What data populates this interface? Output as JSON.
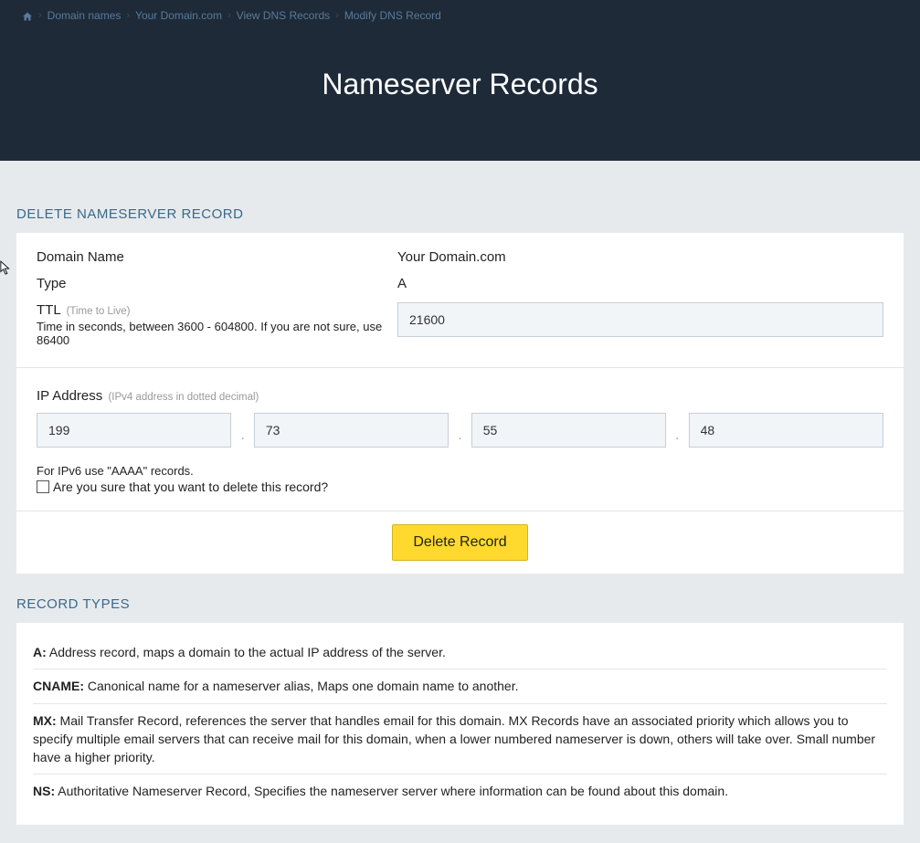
{
  "breadcrumb": {
    "items": [
      "Domain names",
      "Your Domain.com",
      "View DNS Records"
    ],
    "current": "Modify DNS Record"
  },
  "page_title": "Nameserver Records",
  "section_delete_title": "DELETE NAMESERVER RECORD",
  "form": {
    "domain_label": "Domain Name",
    "domain_value": "Your Domain.com",
    "type_label": "Type",
    "type_value": "A",
    "ttl_label": "TTL",
    "ttl_hint": "(Time to Live)",
    "ttl_desc": "Time in seconds, between 3600 - 604800. If you are not sure, use 86400",
    "ttl_value": "21600",
    "ip_label": "IP Address",
    "ip_hint": "(IPv4 address in dotted decimal)",
    "ip": [
      "199",
      "73",
      "55",
      "48"
    ],
    "ipv6_hint": "For IPv6 use \"AAAA\" records.",
    "confirm_label": "Are you sure that you want to delete this record?",
    "delete_btn": "Delete Record"
  },
  "types_title": "RECORD TYPES",
  "types": [
    {
      "k": "A:",
      "v": " Address record, maps a domain to the actual IP address of the server."
    },
    {
      "k": "CNAME:",
      "v": " Canonical name for a nameserver alias, Maps one domain name to another."
    },
    {
      "k": "MX:",
      "v": " Mail Transfer Record, references the server that handles email for this domain. MX Records have an associated priority which allows you to specify multiple email servers that can receive mail for this domain, when a lower numbered nameserver is down, others will take over. Small number have a higher priority."
    },
    {
      "k": "NS:",
      "v": " Authoritative Nameserver Record, Specifies the nameserver server where information can be found about this domain."
    }
  ]
}
